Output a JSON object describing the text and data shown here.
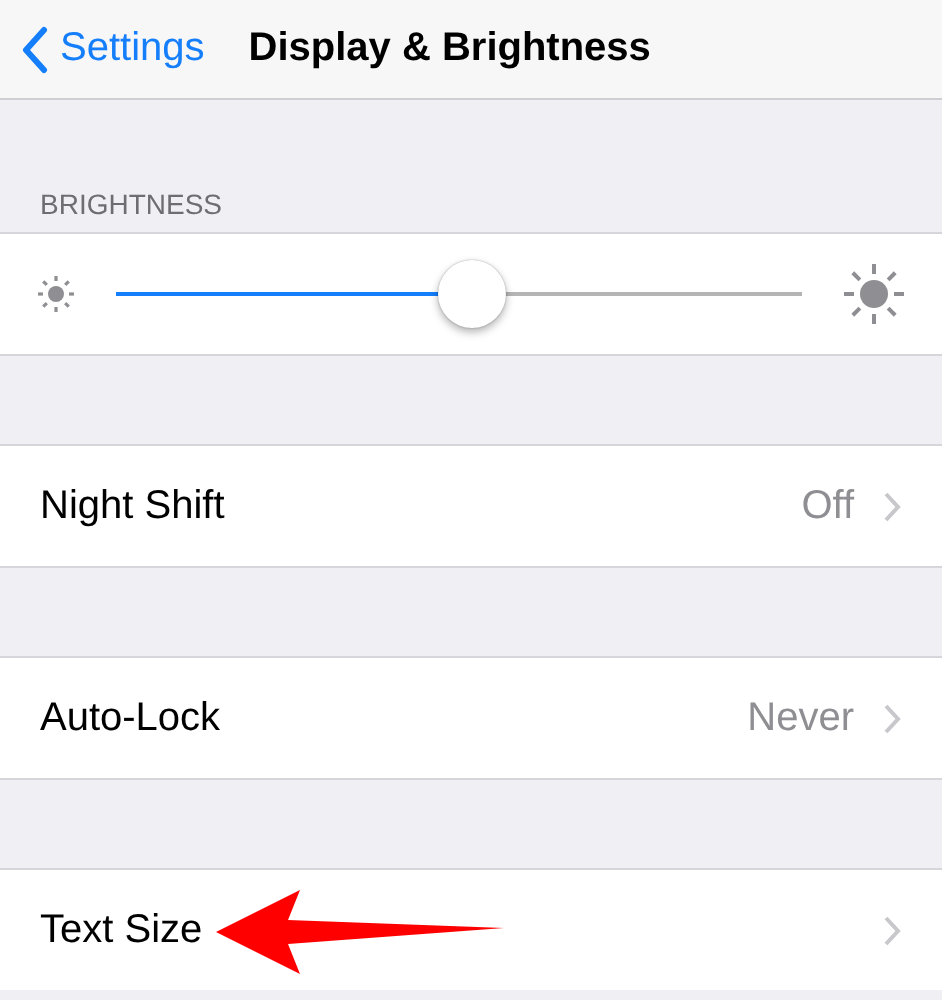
{
  "nav": {
    "back_label": "Settings",
    "title": "Display & Brightness"
  },
  "brightness": {
    "header": "BRIGHTNESS",
    "level": 0.52
  },
  "rows": [
    {
      "label": "Night Shift",
      "value": "Off"
    },
    {
      "label": "Auto-Lock",
      "value": "Never"
    },
    {
      "label": "Text Size"
    }
  ]
}
